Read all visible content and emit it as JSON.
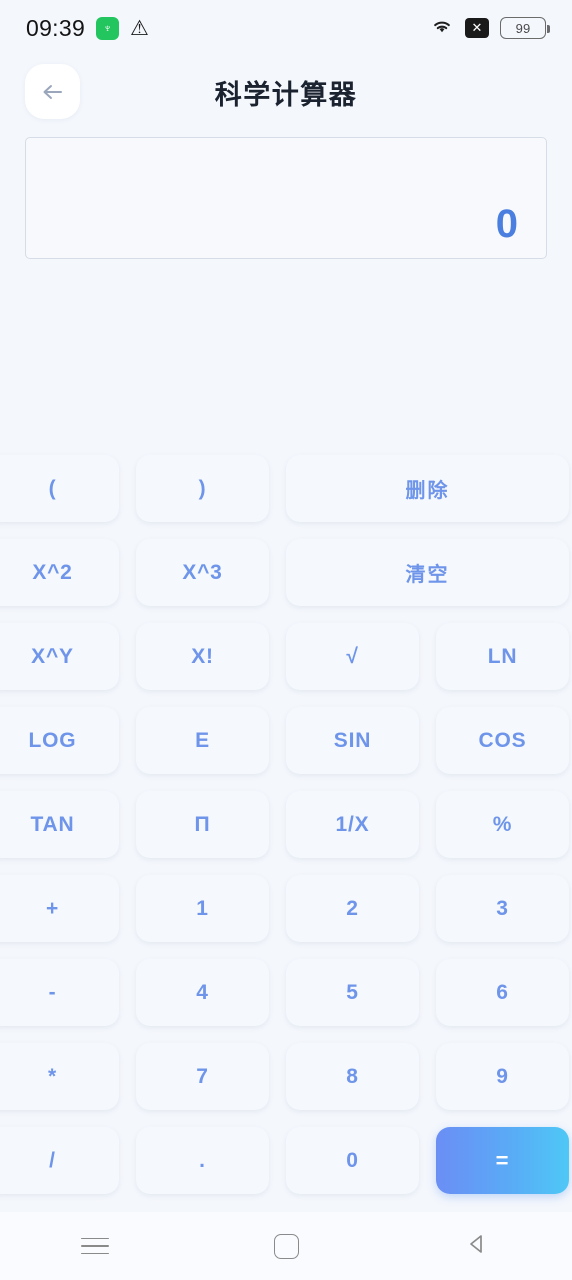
{
  "statusbar": {
    "time": "09:39",
    "app_badge_icon": "green-app-icon",
    "app_badge_glyph": "♆",
    "warning_icon": "warning-triangle-icon",
    "warning_glyph": "⚠",
    "wifi_icon": "wifi-icon",
    "wifi_glyph": "📶",
    "vpn_icon": "x-close-box-icon",
    "vpn_glyph": "✕",
    "battery_icon": "battery-icon",
    "battery_level": "99"
  },
  "header": {
    "back_icon": "back-arrow-icon",
    "title": "科学计算器"
  },
  "display": {
    "value": "0"
  },
  "keypad": {
    "rows": [
      [
        {
          "label": "(",
          "name": "key-open-paren",
          "span": 1,
          "style": "normal"
        },
        {
          "label": ")",
          "name": "key-close-paren",
          "span": 1,
          "style": "normal"
        },
        {
          "label": "删除",
          "name": "key-delete",
          "span": 2,
          "style": "cjk"
        }
      ],
      [
        {
          "label": "X^2",
          "name": "key-square",
          "span": 1,
          "style": "normal"
        },
        {
          "label": "X^3",
          "name": "key-cube",
          "span": 1,
          "style": "normal"
        },
        {
          "label": "清空",
          "name": "key-clear",
          "span": 2,
          "style": "cjk"
        }
      ],
      [
        {
          "label": "X^Y",
          "name": "key-power",
          "span": 1,
          "style": "normal"
        },
        {
          "label": "X!",
          "name": "key-factorial",
          "span": 1,
          "style": "normal"
        },
        {
          "label": "√",
          "name": "key-sqrt",
          "span": 1,
          "style": "normal"
        },
        {
          "label": "LN",
          "name": "key-ln",
          "span": 1,
          "style": "normal"
        }
      ],
      [
        {
          "label": "LOG",
          "name": "key-log",
          "span": 1,
          "style": "normal"
        },
        {
          "label": "E",
          "name": "key-e",
          "span": 1,
          "style": "normal"
        },
        {
          "label": "SIN",
          "name": "key-sin",
          "span": 1,
          "style": "normal"
        },
        {
          "label": "COS",
          "name": "key-cos",
          "span": 1,
          "style": "normal"
        }
      ],
      [
        {
          "label": "TAN",
          "name": "key-tan",
          "span": 1,
          "style": "normal"
        },
        {
          "label": "Π",
          "name": "key-pi",
          "span": 1,
          "style": "normal"
        },
        {
          "label": "1/X",
          "name": "key-reciprocal",
          "span": 1,
          "style": "normal"
        },
        {
          "label": "%",
          "name": "key-percent",
          "span": 1,
          "style": "normal"
        }
      ],
      [
        {
          "label": "+",
          "name": "key-plus",
          "span": 1,
          "style": "normal"
        },
        {
          "label": "1",
          "name": "key-1",
          "span": 1,
          "style": "normal"
        },
        {
          "label": "2",
          "name": "key-2",
          "span": 1,
          "style": "normal"
        },
        {
          "label": "3",
          "name": "key-3",
          "span": 1,
          "style": "normal"
        }
      ],
      [
        {
          "label": "-",
          "name": "key-minus",
          "span": 1,
          "style": "normal"
        },
        {
          "label": "4",
          "name": "key-4",
          "span": 1,
          "style": "normal"
        },
        {
          "label": "5",
          "name": "key-5",
          "span": 1,
          "style": "normal"
        },
        {
          "label": "6",
          "name": "key-6",
          "span": 1,
          "style": "normal"
        }
      ],
      [
        {
          "label": "*",
          "name": "key-multiply",
          "span": 1,
          "style": "normal"
        },
        {
          "label": "7",
          "name": "key-7",
          "span": 1,
          "style": "normal"
        },
        {
          "label": "8",
          "name": "key-8",
          "span": 1,
          "style": "normal"
        },
        {
          "label": "9",
          "name": "key-9",
          "span": 1,
          "style": "normal"
        }
      ],
      [
        {
          "label": "/",
          "name": "key-divide",
          "span": 1,
          "style": "normal"
        },
        {
          "label": ".",
          "name": "key-decimal",
          "span": 1,
          "style": "normal"
        },
        {
          "label": "0",
          "name": "key-0",
          "span": 1,
          "style": "normal"
        },
        {
          "label": "=",
          "name": "key-equals",
          "span": 1,
          "style": "eq"
        }
      ]
    ]
  },
  "navbar": {
    "recents_icon": "menu-icon",
    "home_icon": "home-square-icon",
    "back_icon": "back-triangle-icon"
  },
  "colors": {
    "page_background": "#f4f7fc",
    "key_background": "#f5f8fd",
    "key_text": "#6e95ea",
    "display_value": "#4a7fe0",
    "equals_gradient_start": "#6b8ef5",
    "equals_gradient_end": "#4ec8f6",
    "title_text": "#1b2330"
  }
}
